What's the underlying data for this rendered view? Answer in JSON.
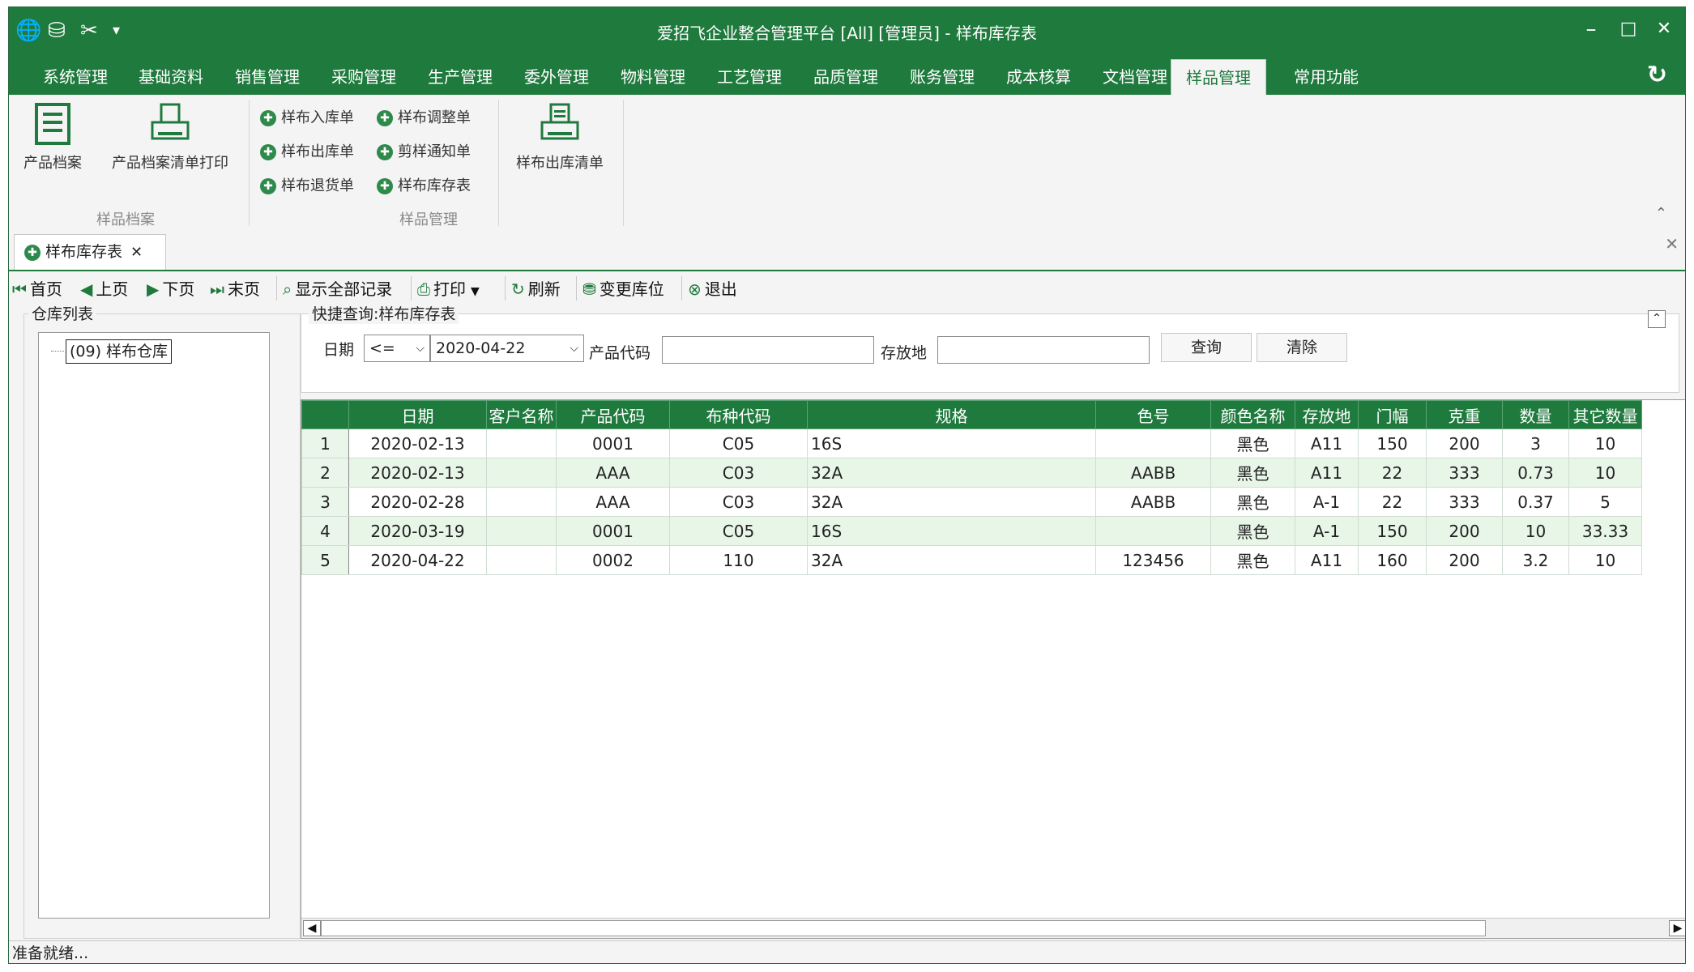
{
  "window": {
    "title": "爱招飞企业整合管理平台 [All] [管理员] - 样布库存表",
    "controls": {
      "minimize": "–",
      "maximize": "□",
      "close": "✕"
    }
  },
  "menu": {
    "items": [
      "系统管理",
      "基础资料",
      "销售管理",
      "采购管理",
      "生产管理",
      "委外管理",
      "物料管理",
      "工艺管理",
      "品质管理",
      "账务管理",
      "成本核算",
      "文档管理",
      "样品管理",
      "常用功能"
    ],
    "active": "样品管理"
  },
  "ribbon": {
    "product_file": "产品档案",
    "product_file_print": "产品档案清单打印",
    "group1_label": "样品档案",
    "small_buttons": [
      "样布入库单",
      "样布调整单",
      "样布出库单",
      "剪样通知单",
      "样布退货单",
      "样布库存表"
    ],
    "out_list": "样布出库清单",
    "group2_label": "样品管理"
  },
  "doc_tab": {
    "label": "样布库存表"
  },
  "toolbar": {
    "first": "首页",
    "prev": "上页",
    "next": "下页",
    "last": "末页",
    "show_all": "显示全部记录",
    "print": "打印",
    "refresh": "刷新",
    "change_location": "变更库位",
    "exit": "退出"
  },
  "warehouse": {
    "panel_title": "仓库列表",
    "items": [
      "(09) 样布仓库"
    ]
  },
  "query": {
    "panel_title": "快捷查询:样布库存表",
    "date_label": "日期",
    "operator": "<=",
    "date_value": "2020-04-22",
    "product_code_label": "产品代码",
    "product_code_value": "",
    "location_label": "存放地",
    "location_value": "",
    "search_button": "查询",
    "clear_button": "清除"
  },
  "grid": {
    "columns": [
      "",
      "日期",
      "客户名称",
      "产品代码",
      "布种代码",
      "规格",
      "色号",
      "颜色名称",
      "存放地",
      "门幅",
      "克重",
      "数量",
      "其它数量"
    ],
    "rows": [
      [
        "1",
        "2020-02-13",
        "",
        "0001",
        "C05",
        "16S",
        "",
        "黑色",
        "A11",
        "150",
        "200",
        "3",
        "10"
      ],
      [
        "2",
        "2020-02-13",
        "",
        "AAA",
        "C03",
        "32A",
        "AABB",
        "黑色",
        "A11",
        "22",
        "333",
        "0.73",
        "10"
      ],
      [
        "3",
        "2020-02-28",
        "",
        "AAA",
        "C03",
        "32A",
        "AABB",
        "黑色",
        "A-1",
        "22",
        "333",
        "0.37",
        "5"
      ],
      [
        "4",
        "2020-03-19",
        "",
        "0001",
        "C05",
        "16S",
        "",
        "黑色",
        "A-1",
        "150",
        "200",
        "10",
        "33.33"
      ],
      [
        "5",
        "2020-04-22",
        "",
        "0002",
        "110",
        "32A",
        "123456",
        "黑色",
        "A11",
        "160",
        "200",
        "3.2",
        "10"
      ]
    ]
  },
  "status": {
    "text": "准备就绪..."
  },
  "colors": {
    "brand": "#1f7a3d",
    "row_even": "#e8f6e8"
  }
}
